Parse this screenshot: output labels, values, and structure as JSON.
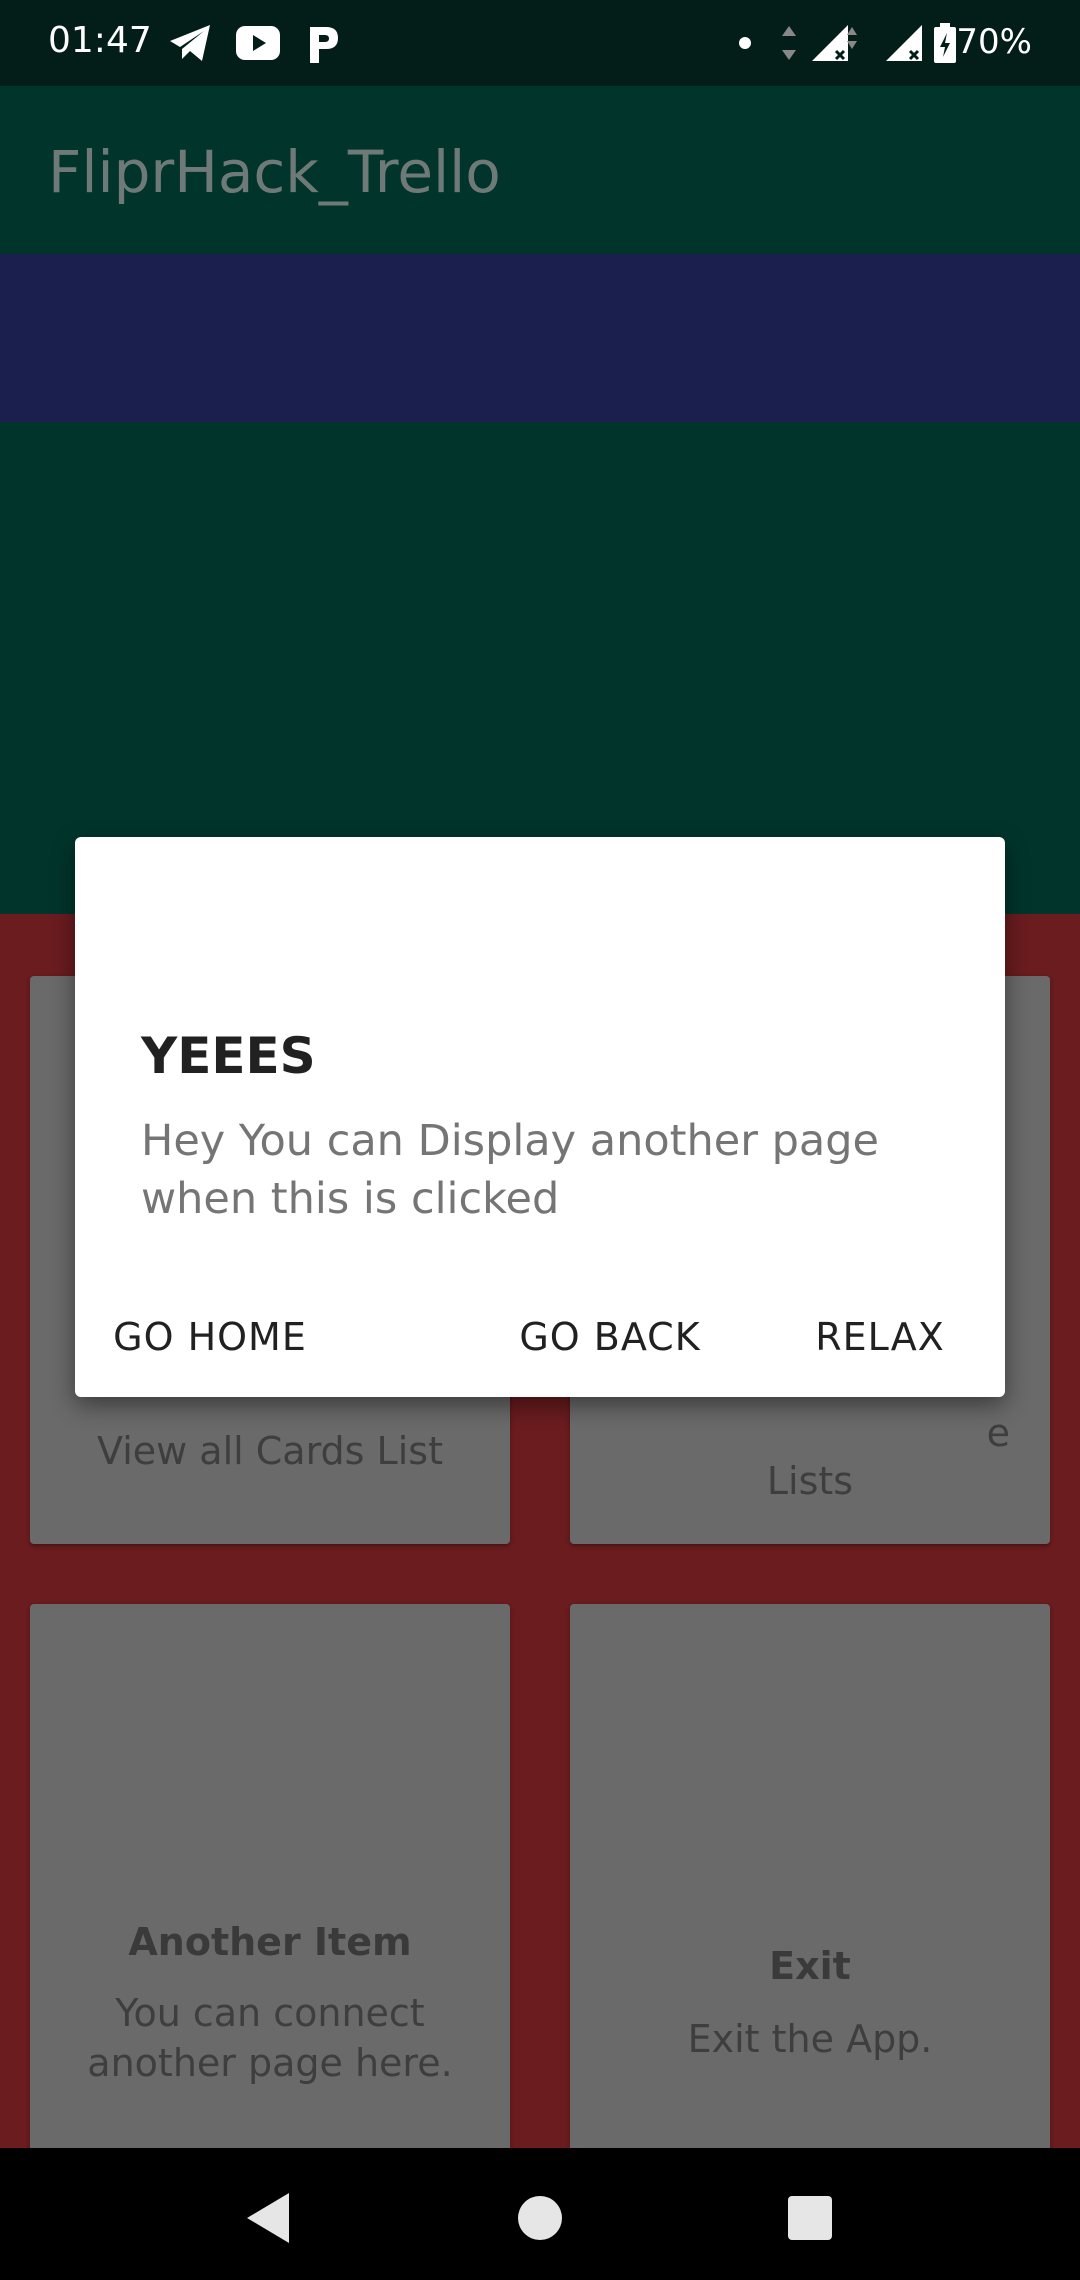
{
  "status_bar": {
    "time": "01:47",
    "battery": "70%",
    "icons": [
      "telegram-icon",
      "youtube-icon",
      "p-app-icon",
      "dot-icon",
      "data-arrows-icon",
      "signal-icon",
      "signal-icon",
      "battery-icon"
    ]
  },
  "app_bar": {
    "title": "FliprHack_Trello"
  },
  "cards": {
    "top_left_desc": "View all Cards List",
    "top_right_desc_line1": "e",
    "top_right_desc_line2": "Lists",
    "bottom_left_title": "Another Item",
    "bottom_left_desc": "You can connect another page here.",
    "bottom_right_title": "Exit",
    "bottom_right_desc": "Exit the App."
  },
  "dialog": {
    "title": "YEEES",
    "message": "Hey You can Display another page when this is clicked",
    "buttons": {
      "home": "GO HOME",
      "back": "GO BACK",
      "relax": "RELAX"
    }
  },
  "colors": {
    "status_bar": "#031e19",
    "app_bar": "#01352c",
    "banner": "#1a1f4d",
    "grid_bg": "#6b1c1f",
    "card": "#6a6a6a",
    "dialog": "#ffffff"
  },
  "nav_bar": {
    "icons": [
      "back-icon",
      "home-icon",
      "recents-icon"
    ]
  }
}
